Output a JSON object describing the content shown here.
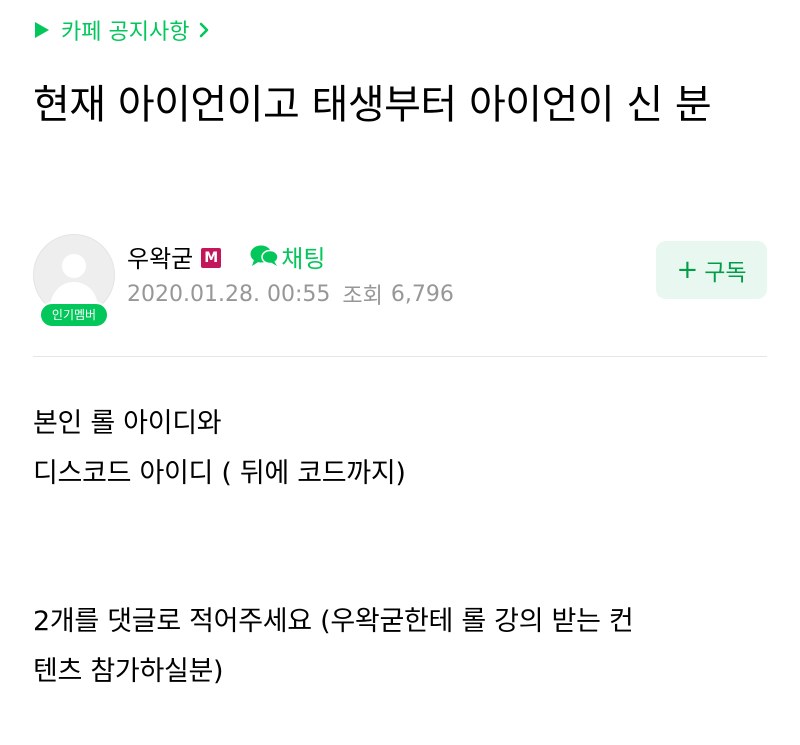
{
  "board": {
    "name": "카페 공지사항",
    "icon": "play-icon",
    "chevron": "chevron-right-icon"
  },
  "post": {
    "title": "현재 아이언이고 태생부터 아이언이 신 분",
    "author": {
      "nickname": "우왁굳",
      "badge": "M",
      "member_level": "인기멤버"
    },
    "chat_label": "채팅",
    "date": "2020.01.28. 00:55",
    "views_label": "조회",
    "views_count": "6,796",
    "subscribe_label": "구독",
    "body_lines": [
      "본인 롤 아이디와",
      "디스코드 아이디 ( 뒤에 코드까지)",
      "2개를 댓글로 적어주세요 (우왁굳한테 롤 강의 받는 컨",
      "텐츠 참가하실분)"
    ]
  },
  "colors": {
    "accent_green": "#03c75a",
    "subscribe_bg": "#e8f7ef",
    "subscribe_text": "#009f47",
    "meta_gray": "#979797",
    "manager_badge": "#c2185b"
  }
}
